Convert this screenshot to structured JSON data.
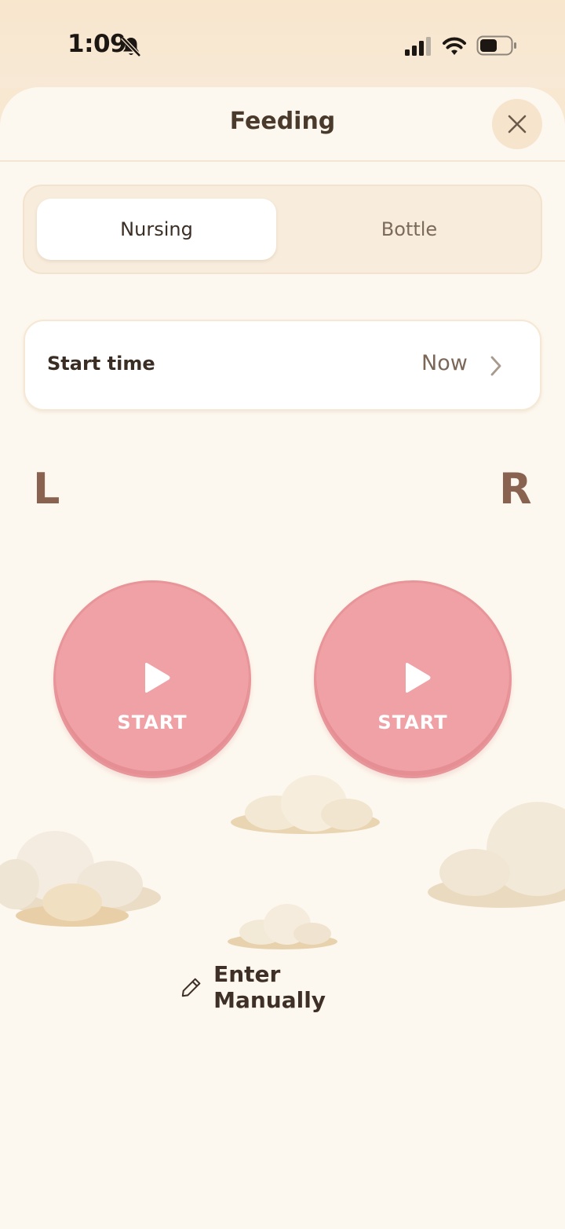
{
  "status_bar": {
    "time": "1:09",
    "icons": [
      "bell-slash-icon",
      "cellular-signal-icon",
      "wifi-icon",
      "battery-icon"
    ]
  },
  "header": {
    "title": "Feeding",
    "close_icon": "close-icon"
  },
  "feeding_type": {
    "options": [
      {
        "label": "Nursing",
        "selected": true
      },
      {
        "label": "Bottle",
        "selected": false
      }
    ]
  },
  "start_time": {
    "label": "Start time",
    "value": "Now"
  },
  "sides": {
    "left": {
      "label": "L",
      "button_label": "START"
    },
    "right": {
      "label": "R",
      "button_label": "START"
    }
  },
  "footer": {
    "enter_manually_label": "Enter Manually"
  },
  "colors": {
    "background": "#fdf8ef",
    "status_bar": "#f8e6cd",
    "start_button": "#f0a1a6",
    "side_label": "#8a6350",
    "text_dark": "#4a3a2b"
  }
}
